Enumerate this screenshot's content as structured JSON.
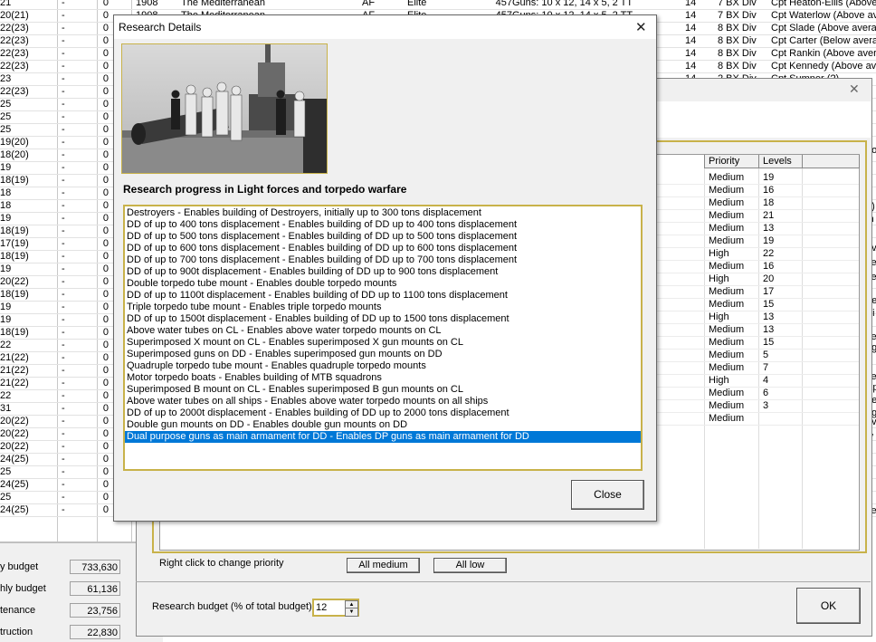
{
  "bg_rows": [
    {
      "c0": "21",
      "c1": "-",
      "c2": "0",
      "c3": "1908",
      "c4": "The Mediterranean",
      "c5": "AF",
      "c6": "Elite",
      "c7": "457",
      "c8": "Guns: 10 x 12, 14 x 5, 2 TT",
      "c9": "14",
      "c10": "7 BX Div",
      "c11": "Cpt Heaton-Ellis (Above ave"
    },
    {
      "c0": "20(21)",
      "c1": "-",
      "c2": "0",
      "c3": "1908",
      "c4": "The Mediterranean",
      "c5": "AF",
      "c6": "Elite",
      "c7": "457",
      "c8": "Guns: 10 x 12, 14 x 5, 2 TT",
      "c9": "14",
      "c10": "7 BX Div",
      "c11": "Cpt Waterlow (Above average"
    },
    {
      "c0": "22(23)",
      "c1": "-",
      "c2": "0",
      "c3": "",
      "c4": "",
      "c5": "",
      "c6": "",
      "c7": "",
      "c8": "",
      "c9": "14",
      "c10": "8 BX Div",
      "c11": "Cpt Slade (Above averag"
    },
    {
      "c0": "22(23)",
      "c1": "-",
      "c2": "0",
      "c3": "",
      "c4": "",
      "c5": "",
      "c6": "",
      "c7": "",
      "c8": "",
      "c9": "14",
      "c10": "8 BX Div",
      "c11": "Cpt Carter (Below average"
    },
    {
      "c0": "22(23)",
      "c1": "-",
      "c2": "0",
      "c3": "",
      "c4": "",
      "c5": "",
      "c6": "",
      "c7": "",
      "c8": "",
      "c9": "14",
      "c10": "8 BX Div",
      "c11": "Cpt Rankin (Above avera"
    },
    {
      "c0": "22(23)",
      "c1": "-",
      "c2": "0",
      "c3": "",
      "c4": "",
      "c5": "",
      "c6": "",
      "c7": "",
      "c8": "",
      "c9": "14",
      "c10": "8 BX Div",
      "c11": "Cpt Kennedy (Above avera"
    },
    {
      "c0": "23",
      "c1": "-",
      "c2": "0",
      "c3": "",
      "c4": "",
      "c5": "",
      "c6": "",
      "c7": "",
      "c8": "",
      "c9": "14",
      "c10": "2 BX Div",
      "c11": "Cpt Sumner (?)"
    },
    {
      "c0": "22(23)",
      "c1": "-",
      "c2": "0"
    },
    {
      "c0": "25",
      "c1": "-",
      "c2": "0"
    },
    {
      "c0": "25",
      "c1": "-",
      "c2": "0"
    },
    {
      "c0": "25",
      "c1": "-",
      "c2": "0"
    },
    {
      "c0": "19(20)",
      "c1": "-",
      "c2": "0"
    },
    {
      "c0": "18(20)",
      "c1": "-",
      "c2": "0"
    },
    {
      "c0": "19",
      "c1": "-",
      "c2": "0"
    },
    {
      "c0": "18(19)",
      "c1": "-",
      "c2": "0"
    },
    {
      "c0": "18",
      "c1": "-",
      "c2": "0"
    },
    {
      "c0": "18",
      "c1": "-",
      "c2": "0"
    },
    {
      "c0": "19",
      "c1": "-",
      "c2": "0"
    },
    {
      "c0": "18(19)",
      "c1": "-",
      "c2": "0"
    },
    {
      "c0": "17(19)",
      "c1": "-",
      "c2": "0"
    },
    {
      "c0": "18(19)",
      "c1": "-",
      "c2": "0"
    },
    {
      "c0": "19",
      "c1": "-",
      "c2": "0"
    },
    {
      "c0": "20(22)",
      "c1": "-",
      "c2": "0"
    },
    {
      "c0": "18(19)",
      "c1": "-",
      "c2": "0"
    },
    {
      "c0": "19",
      "c1": "-",
      "c2": "0"
    },
    {
      "c0": "19",
      "c1": "-",
      "c2": "0"
    },
    {
      "c0": "18(19)",
      "c1": "-",
      "c2": "0"
    },
    {
      "c0": "22",
      "c1": "-",
      "c2": "0"
    },
    {
      "c0": "21(22)",
      "c1": "-",
      "c2": "0"
    },
    {
      "c0": "21(22)",
      "c1": "-",
      "c2": "0"
    },
    {
      "c0": "21(22)",
      "c1": "-",
      "c2": "0"
    },
    {
      "c0": "22",
      "c1": "-",
      "c2": "0"
    },
    {
      "c0": "31",
      "c1": "-",
      "c2": "0"
    },
    {
      "c0": "20(22)",
      "c1": "-",
      "c2": "0"
    },
    {
      "c0": "20(22)",
      "c1": "-",
      "c2": "0"
    },
    {
      "c0": "20(22)",
      "c1": "-",
      "c2": "0"
    },
    {
      "c0": "24(25)",
      "c1": "-",
      "c2": "0"
    },
    {
      "c0": "25",
      "c1": "-",
      "c2": "0"
    },
    {
      "c0": "24(25)",
      "c1": "-",
      "c2": "0"
    },
    {
      "c0": "25",
      "c1": "-",
      "c2": "0"
    },
    {
      "c0": "24(25)",
      "c1": "-",
      "c2": "0"
    }
  ],
  "right_edge_fragments": [
    "bove",
    "e)",
    "in",
    "ave",
    "ve",
    "ve",
    "ge",
    "Vi",
    "T",
    "ve",
    "ag",
    "ve",
    "Sp",
    "ge",
    "ag",
    "ave",
    "w",
    "S",
    "ve"
  ],
  "budget": [
    {
      "label": "y budget",
      "value": "733,630"
    },
    {
      "label": "hly budget",
      "value": "61,136"
    },
    {
      "label": "tenance",
      "value": "23,756"
    },
    {
      "label": "truction",
      "value": "22,830"
    }
  ],
  "back_dialog": {
    "headers": {
      "priority": "Priority",
      "levels": "Levels"
    },
    "rows": [
      {
        "priority": "Medium",
        "levels": "19"
      },
      {
        "priority": "Medium",
        "levels": "16"
      },
      {
        "priority": "Medium",
        "levels": "18"
      },
      {
        "priority": "Medium",
        "levels": "21"
      },
      {
        "priority": "Medium",
        "levels": "13"
      },
      {
        "priority": "Medium",
        "levels": "19"
      },
      {
        "priority": "High",
        "levels": "22"
      },
      {
        "priority": "Medium",
        "levels": "16"
      },
      {
        "priority": "High",
        "levels": "20"
      },
      {
        "priority": "Medium",
        "levels": "17"
      },
      {
        "priority": "Medium",
        "levels": "15"
      },
      {
        "priority": "High",
        "levels": "13"
      },
      {
        "priority": "Medium",
        "levels": "13"
      },
      {
        "priority": "Medium",
        "levels": "15"
      },
      {
        "priority": "Medium",
        "levels": "5"
      },
      {
        "priority": "Medium",
        "levels": "7"
      },
      {
        "priority": "High",
        "levels": "4"
      },
      {
        "priority": "Medium",
        "levels": "6"
      },
      {
        "priority": "Medium",
        "levels": "3"
      },
      {
        "priority": "Medium",
        "levels": ""
      }
    ],
    "hint": "Right click to change priority",
    "all_medium": "All medium",
    "all_low": "All low",
    "budget_label": "Research budget (% of total budget)",
    "budget_value": "12",
    "ok": "OK",
    "close_glyph": "✕"
  },
  "dialog": {
    "title": "Research Details",
    "close_glyph": "✕",
    "heading": "Research progress in Light forces and torpedo warfare",
    "close_button": "Close",
    "items": [
      "Destroyers - Enables building of Destroyers, initially up to 300 tons displacement",
      "DD of up to 400 tons displacement - Enables building of DD up to 400 tons displacement",
      "DD of up to 500 tons displacement - Enables building of DD up to 500 tons displacement",
      "DD of up to 600 tons displacement - Enables building of DD up to 600 tons displacement",
      "DD of up to 700 tons displacement - Enables building of DD up to 700 tons displacement",
      "DD of up to 900t displacement - Enables building of DD up to 900 tons displacement",
      "Double torpedo tube mount - Enables double torpedo mounts",
      "DD of up to 1100t displacement - Enables building of DD up to 1100 tons displacement",
      "Triple torpedo tube mount - Enables triple torpedo mounts",
      "DD of up to 1500t displacement - Enables building of DD up to 1500 tons displacement",
      "Above water tubes on CL - Enables above water torpedo mounts on CL",
      "Superimposed X mount on CL - Enables superimposed X gun mounts on CL",
      "Superimposed guns on DD - Enables superimposed gun mounts on DD",
      "Quadruple torpedo tube mount - Enables quadruple torpedo mounts",
      "Motor torpedo boats - Enables building of MTB squadrons",
      "Superimposed B mount on CL - Enables superimposed B gun mounts on CL",
      "Above water tubes on all ships - Enables above water torpedo mounts on all ships",
      "DD of up to 2000t displacement - Enables building of DD up to 2000 tons displacement",
      "Double gun mounts on DD - Enables double gun mounts on DD",
      "Dual purpose guns as main armament for DD - Enables DP guns as main armament for DD"
    ],
    "selected_index": 19
  },
  "colors": {
    "selection": "#0078d7",
    "gold_border": "#c8b24a",
    "dialog_bg": "#f0f0f0"
  }
}
